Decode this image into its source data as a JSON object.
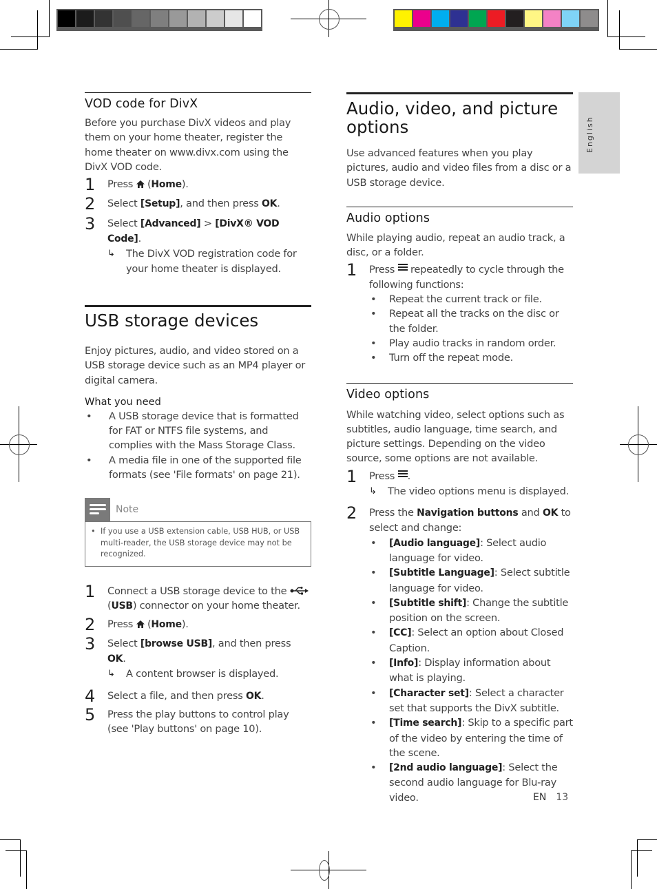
{
  "print_marks": {
    "grayscale_swatches": [
      "#000000",
      "#1c1c1c",
      "#333333",
      "#4f4f4f",
      "#666666",
      "#7f7f7f",
      "#999999",
      "#b2b2b2",
      "#cccccc",
      "#e6e6e6",
      "#ffffff"
    ],
    "color_swatches": [
      "#fff200",
      "#ec008c",
      "#00aeef",
      "#2e3192",
      "#00a651",
      "#ed1c24",
      "#231f20",
      "#fff685",
      "#f482c5",
      "#7fd3f7",
      "#8e8c8c"
    ]
  },
  "side_tab": {
    "label": "English"
  },
  "left_column": {
    "vod": {
      "heading": "VOD code for DivX",
      "intro": "Before you purchase DivX videos and play them on your home theater, register the home theater on www.divx.com using the DivX VOD code.",
      "steps": [
        {
          "num": "1",
          "pre": "Press ",
          "icon": "home-icon",
          "paren_open": " (",
          "bold": "Home",
          "post": ")."
        },
        {
          "num": "2",
          "pre": "Select ",
          "bold": "[Setup]",
          "mid": ", and then press ",
          "bold2": "OK",
          "post": "."
        },
        {
          "num": "3",
          "pre": "Select ",
          "bold": "[Advanced]",
          "mid": " > ",
          "bold2": "[DivX® VOD Code]",
          "post": "."
        }
      ],
      "result": "The DivX VOD registration code for your home theater is displayed."
    },
    "usb": {
      "heading": "USB storage devices",
      "intro": "Enjoy pictures, audio, and video stored on a USB storage device such as an MP4 player or digital camera.",
      "need_label": "What you need",
      "needs": [
        "A USB storage device that is formatted for FAT or NTFS file systems, and complies with the Mass Storage Class.",
        "A media file in one of the supported file formats (see 'File formats' on page 21)."
      ],
      "note_label": "Note",
      "note_text": "If you use a USB extension cable, USB HUB, or USB multi-reader, the USB storage device may not be recognized.",
      "steps": [
        {
          "num": "1",
          "pre": "Connect a USB storage device to the ",
          "paren": " (",
          "bold": "USB",
          "post": ") connector on your home theater."
        },
        {
          "num": "2",
          "pre": "Press ",
          "paren": " (",
          "bold": "Home",
          "post": ")."
        },
        {
          "num": "3",
          "pre": "Select ",
          "bold": "[browse USB]",
          "mid": ", and then press ",
          "bold2": "OK",
          "post": "."
        },
        {
          "num": "4",
          "pre": "Select a file, and then press ",
          "bold": "OK",
          "post": "."
        },
        {
          "num": "5",
          "pre": "Press the play buttons to control play (see 'Play buttons' on page 10)."
        }
      ],
      "step3_result": "A content browser is displayed."
    }
  },
  "right_column": {
    "heading": "Audio, video, and picture options",
    "intro": "Use advanced features when you play pictures, audio and video files from a disc or a USB storage device.",
    "audio": {
      "heading": "Audio options",
      "intro": "While playing audio, repeat an audio track, a disc, or a folder.",
      "step1_num": "1",
      "step1_pre": "Press ",
      "step1_post": " repeatedly to cycle through the following functions:",
      "functions": [
        "Repeat the current track or file.",
        "Repeat all the tracks on the disc or the folder.",
        "Play audio tracks in random order.",
        "Turn off the repeat mode."
      ]
    },
    "video": {
      "heading": "Video options",
      "intro": "While watching video, select options such as subtitles, audio language, time search, and picture settings. Depending on the video source, some options are not available.",
      "step1_num": "1",
      "step1_pre": "Press ",
      "step1_post": ".",
      "step1_result": "The video options menu is displayed.",
      "step2_num": "2",
      "step2_pre": "Press the ",
      "step2_bold": "Navigation buttons",
      "step2_mid": " and ",
      "step2_bold2": "OK",
      "step2_post": " to select and change:",
      "options": [
        {
          "name": "[Audio language]",
          "desc": ": Select audio language for video."
        },
        {
          "name": "[Subtitle Language]",
          "desc": ": Select subtitle language for video."
        },
        {
          "name": "[Subtitle shift]",
          "desc": ": Change the subtitle position on the screen."
        },
        {
          "name": "[CC]",
          "desc": ": Select an option about Closed Caption."
        },
        {
          "name": "[Info]",
          "desc": ": Display information about what is playing."
        },
        {
          "name": "[Character set]",
          "desc": ": Select a character set that supports the DivX subtitle."
        },
        {
          "name": "[Time search]",
          "desc": ": Skip to a specific part of the video by entering the time of the scene."
        },
        {
          "name": "[2nd audio language]",
          "desc": ": Select the second audio language for Blu-ray video."
        }
      ]
    }
  },
  "footer": {
    "lang": "EN",
    "page": "13"
  }
}
